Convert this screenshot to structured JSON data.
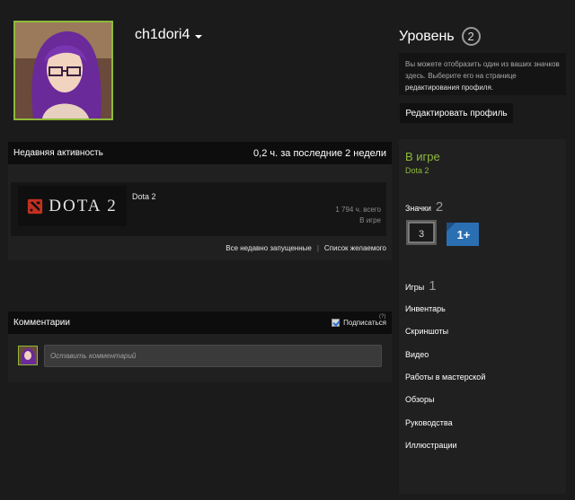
{
  "profile": {
    "username": "ch1dori4"
  },
  "level": {
    "title": "Уровень",
    "value": "2",
    "info_text": "Вы можете отобразить один из ваших значков здесь. Выберите его на странице",
    "info_link": "редактирования профиля.",
    "edit_button": "Редактировать профиль"
  },
  "activity": {
    "title": "Недавняя активность",
    "summary": "0,2 ч. за последние 2 недели",
    "game": {
      "logo_text": "DOTA 2",
      "name": "Dota 2",
      "hours": "1 794 ч. всего",
      "status": "В игре"
    },
    "links": {
      "recent": "Все недавно запущенные",
      "separator": "|",
      "wishlist": "Список желаемого"
    }
  },
  "comments": {
    "title": "Комментарии",
    "subscribe": "Подписаться",
    "help": "(?)",
    "placeholder": "Оставить комментарий"
  },
  "sidebar": {
    "ingame_title": "В игре",
    "ingame_game": "Dota 2",
    "badges_label": "Значки",
    "badges_count": "2",
    "badge1_value": "3",
    "badge2_value": "1+",
    "games_label": "Игры",
    "games_count": "1",
    "items": [
      "Инвентарь",
      "Скриншоты",
      "Видео",
      "Работы в мастерской",
      "Обзоры",
      "Руководства",
      "Иллюстрации"
    ]
  },
  "colors": {
    "accent_green": "#8fb93b",
    "badge_blue": "#2b6fb3"
  }
}
